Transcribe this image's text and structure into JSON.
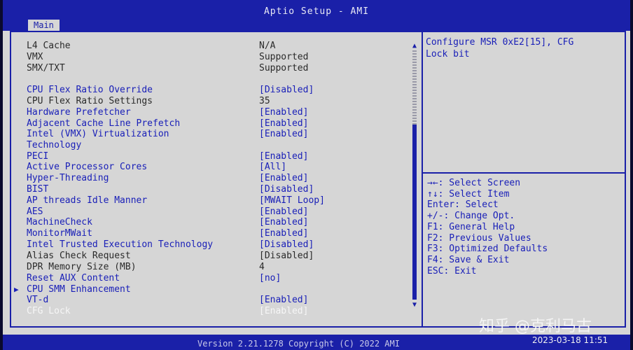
{
  "app": {
    "title": "Aptio Setup - AMI"
  },
  "tabs": [
    {
      "label": "Main"
    }
  ],
  "settings": [
    {
      "label": "L4 Cache",
      "value": "N/A",
      "kind": "static"
    },
    {
      "label": "VMX",
      "value": "Supported",
      "kind": "static"
    },
    {
      "label": "SMX/TXT",
      "value": "Supported",
      "kind": "static"
    },
    {
      "label": "CPU Flex Ratio Override",
      "value": "[Disabled]",
      "kind": "inter"
    },
    {
      "label": "CPU Flex Ratio Settings",
      "value": "35",
      "kind": "static"
    },
    {
      "label": "Hardware Prefetcher",
      "value": "[Enabled]",
      "kind": "inter"
    },
    {
      "label": "Adjacent Cache Line Prefetch",
      "value": "[Enabled]",
      "kind": "inter"
    },
    {
      "label": "Intel (VMX) Virtualization",
      "value": "[Enabled]",
      "kind": "inter"
    },
    {
      "label": "Technology",
      "value": "",
      "kind": "inter"
    },
    {
      "label": "PECI",
      "value": "[Enabled]",
      "kind": "inter"
    },
    {
      "label": "Active Processor Cores",
      "value": "[All]",
      "kind": "inter"
    },
    {
      "label": "Hyper-Threading",
      "value": "[Enabled]",
      "kind": "inter"
    },
    {
      "label": "BIST",
      "value": "[Disabled]",
      "kind": "inter"
    },
    {
      "label": "AP threads Idle Manner",
      "value": "[MWAIT Loop]",
      "kind": "inter"
    },
    {
      "label": "AES",
      "value": "[Enabled]",
      "kind": "inter"
    },
    {
      "label": "MachineCheck",
      "value": "[Enabled]",
      "kind": "inter"
    },
    {
      "label": "MonitorMWait",
      "value": "[Enabled]",
      "kind": "inter"
    },
    {
      "label": "Intel Trusted Execution Technology",
      "value": "[Disabled]",
      "kind": "inter"
    },
    {
      "label": "Alias Check Request",
      "value": "[Disabled]",
      "kind": "static"
    },
    {
      "label": "DPR Memory Size (MB)",
      "value": "4",
      "kind": "static"
    },
    {
      "label": "Reset AUX Content",
      "value": "[no]",
      "kind": "inter"
    },
    {
      "label": "CPU SMM Enhancement",
      "value": "",
      "kind": "inter",
      "submenu": true
    },
    {
      "label": "VT-d",
      "value": "[Enabled]",
      "kind": "inter"
    },
    {
      "label": "CFG Lock",
      "value": "[Enabled]",
      "kind": "grey"
    }
  ],
  "help": {
    "text": "Configure MSR 0xE2[15], CFG\nLock bit"
  },
  "keys": [
    "→←: Select Screen",
    "↑↓: Select Item",
    "Enter: Select",
    "+/-: Change Opt.",
    "F1: General Help",
    "F2: Previous Values",
    "F3: Optimized Defaults",
    "F4: Save & Exit",
    "ESC: Exit"
  ],
  "status": {
    "version": "Version 2.21.1278 Copyright (C) 2022 AMI"
  },
  "overlay": {
    "watermark": "知乎 @克利马古",
    "datestamp": "2023-03-18 11:51"
  },
  "colors": {
    "accent": "#1a20a8",
    "background": "#d6d6d6",
    "highlight": "#f6f6f6"
  },
  "icons": {
    "submenu_marker": "triangle-right-icon",
    "scroll_up": "triangle-up-icon",
    "scroll_down": "triangle-down-icon"
  }
}
